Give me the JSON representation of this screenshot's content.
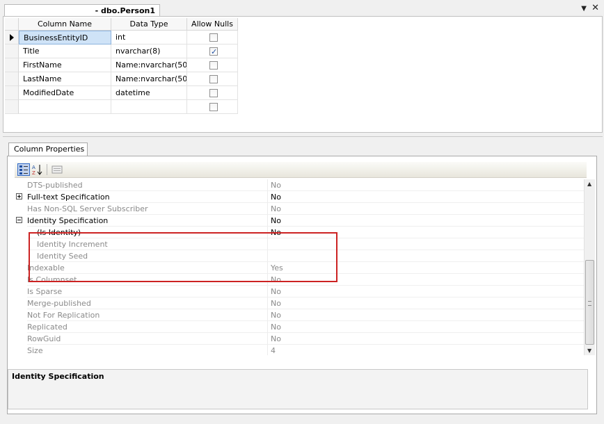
{
  "document_tab": {
    "title": "- dbo.Person1"
  },
  "window_controls": {
    "dropdown_glyph": "▼",
    "close_glyph": "✕"
  },
  "designer": {
    "columns_header": {
      "name": "Column Name",
      "type": "Data Type",
      "nulls": "Allow Nulls"
    },
    "rows": [
      {
        "name": "BusinessEntityID",
        "type": "int",
        "allow_nulls": false,
        "selected": true
      },
      {
        "name": "Title",
        "type": "nvarchar(8)",
        "allow_nulls": true,
        "selected": false
      },
      {
        "name": "FirstName",
        "type": "Name:nvarchar(50)",
        "allow_nulls": false,
        "selected": false
      },
      {
        "name": "LastName",
        "type": "Name:nvarchar(50)",
        "allow_nulls": false,
        "selected": false
      },
      {
        "name": "ModifiedDate",
        "type": "datetime",
        "allow_nulls": false,
        "selected": false
      },
      {
        "name": "",
        "type": "",
        "allow_nulls": false,
        "selected": false
      }
    ]
  },
  "column_properties": {
    "tab_label": "Column Properties",
    "toolbar": {
      "categorized_icon": "categorized-icon",
      "alphabetical_icon": "sort-az-icon",
      "pages_icon": "property-pages-icon"
    },
    "properties": [
      {
        "name": "DTS-published",
        "value": "No",
        "state": "dim"
      },
      {
        "name": "Full-text Specification",
        "value": "No",
        "state": "collapsed"
      },
      {
        "name": "Has Non-SQL Server Subscriber",
        "value": "No",
        "state": "dim"
      },
      {
        "name": "Identity Specification",
        "value": "No",
        "state": "expanded"
      },
      {
        "name": "(Is Identity)",
        "value": "No",
        "state": "sub"
      },
      {
        "name": "Identity Increment",
        "value": "",
        "state": "subdim"
      },
      {
        "name": "Identity Seed",
        "value": "",
        "state": "subdim"
      },
      {
        "name": "Indexable",
        "value": "Yes",
        "state": "dim"
      },
      {
        "name": "Is Columnset",
        "value": "No",
        "state": "dim"
      },
      {
        "name": "Is Sparse",
        "value": "No",
        "state": "dim"
      },
      {
        "name": "Merge-published",
        "value": "No",
        "state": "dim"
      },
      {
        "name": "Not For Replication",
        "value": "No",
        "state": "dim"
      },
      {
        "name": "Replicated",
        "value": "No",
        "state": "dim"
      },
      {
        "name": "RowGuid",
        "value": "No",
        "state": "dim"
      },
      {
        "name": "Size",
        "value": "4",
        "state": "dim"
      }
    ],
    "description_title": "Identity Specification",
    "highlight_color": "#cc2222"
  }
}
